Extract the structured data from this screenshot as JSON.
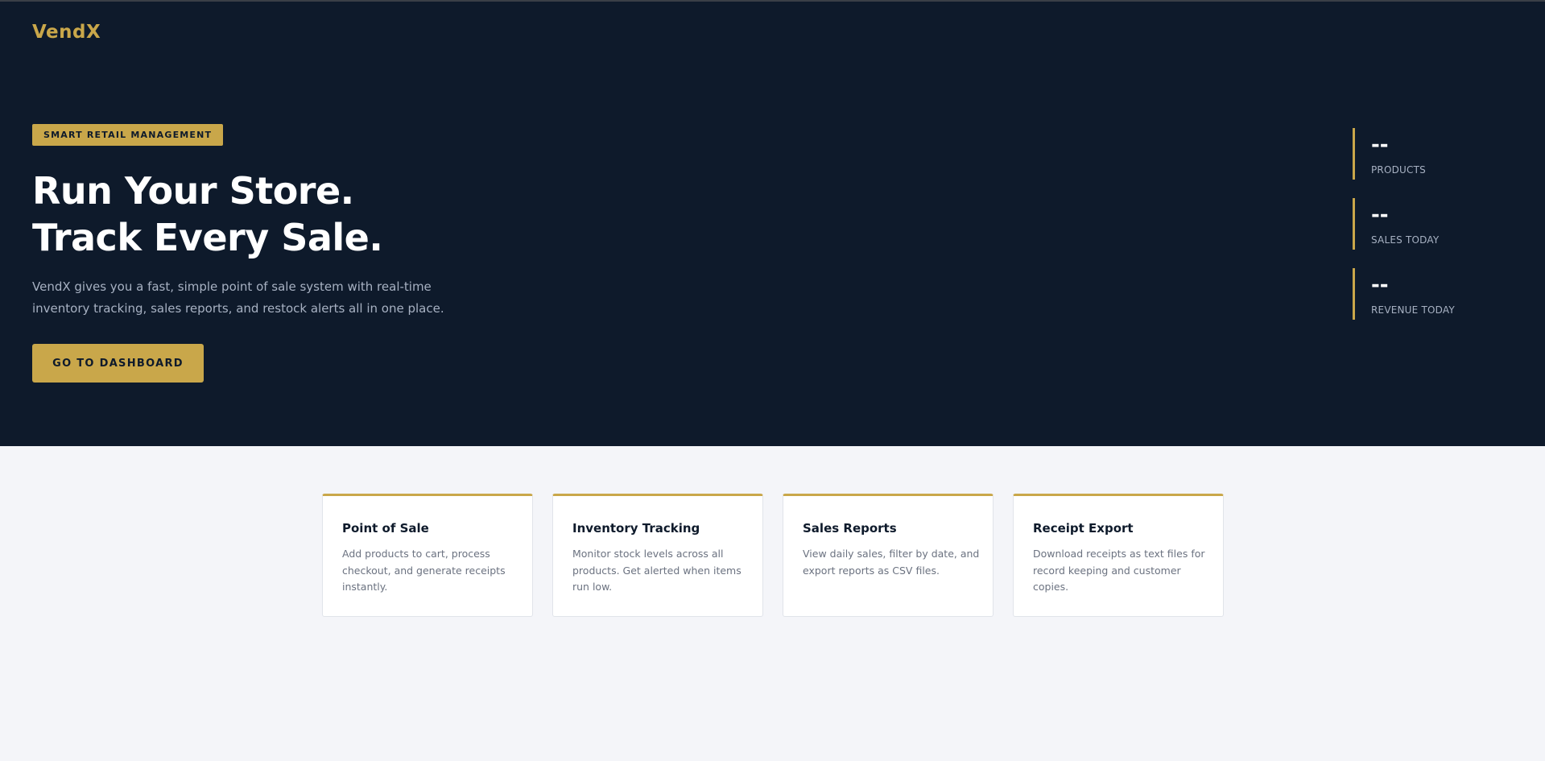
{
  "brand": {
    "logo": "VendX",
    "accent_color": "#c9a74a",
    "hero_background": "#0e1a2b",
    "page_background": "#f4f5f9"
  },
  "hero": {
    "badge": "SMART RETAIL MANAGEMENT",
    "title_line1": "Run Your Store.",
    "title_line2": "Track Every Sale.",
    "description": "VendX gives you a fast, simple point of sale system with real-time inventory tracking, sales reports, and restock alerts all in one place.",
    "cta_label": "GO TO DASHBOARD"
  },
  "stats": [
    {
      "value": "--",
      "label": "PRODUCTS"
    },
    {
      "value": "--",
      "label": "SALES TODAY"
    },
    {
      "value": "--",
      "label": "REVENUE TODAY"
    }
  ],
  "features": [
    {
      "title": "Point of Sale",
      "description": "Add products to cart, process checkout, and generate receipts instantly."
    },
    {
      "title": "Inventory Tracking",
      "description": "Monitor stock levels across all products. Get alerted when items run low."
    },
    {
      "title": "Sales Reports",
      "description": "View daily sales, filter by date, and export reports as CSV files."
    },
    {
      "title": "Receipt Export",
      "description": "Download receipts as text files for record keeping and customer copies."
    }
  ]
}
